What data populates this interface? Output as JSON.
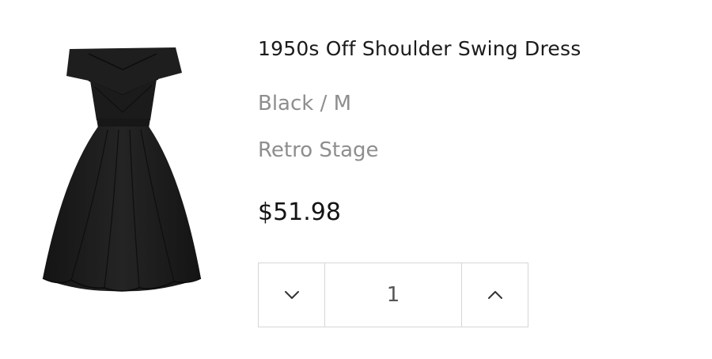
{
  "product": {
    "title": "1950s Off Shoulder Swing Dress",
    "variant": "Black / M",
    "vendor": "Retro Stage",
    "price": "$51.98",
    "image_icon": "dress-image"
  },
  "quantity": {
    "value": "1",
    "decrease_icon": "chevron-down-icon",
    "increase_icon": "chevron-up-icon"
  },
  "colors": {
    "title": "#1b1b1b",
    "muted": "#8e8e8e",
    "border": "#d6d6d6",
    "dress": "#1c1c1c"
  }
}
